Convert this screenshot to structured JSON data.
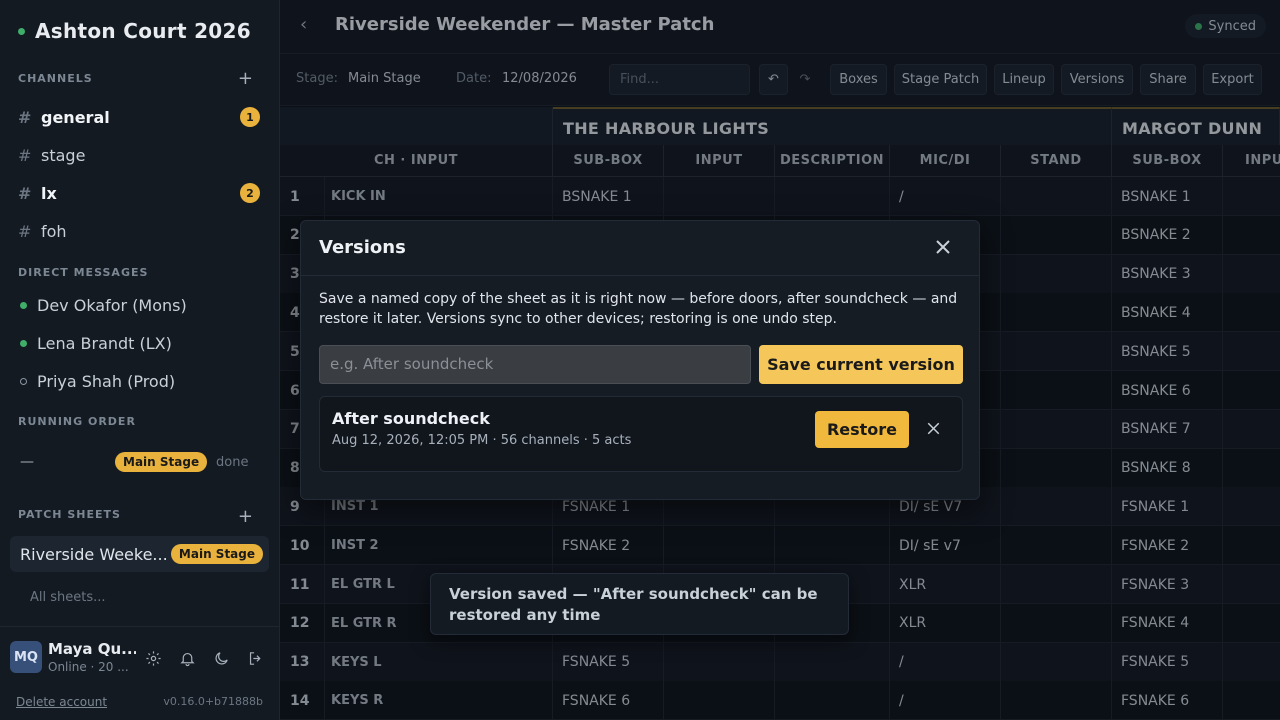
{
  "sidebar": {
    "workspace": "Ashton Court 2026",
    "sections": {
      "channels": "CHANNELS",
      "dms": "DIRECT MESSAGES",
      "running_order": "RUNNING ORDER",
      "patch_sheets": "PATCH SHEETS"
    },
    "channels": [
      {
        "name": "general",
        "badge": "1",
        "bold": true
      },
      {
        "name": "stage",
        "badge": "",
        "bold": false
      },
      {
        "name": "lx",
        "badge": "2",
        "bold": true
      },
      {
        "name": "foh",
        "badge": "",
        "bold": false
      }
    ],
    "dms": [
      {
        "name": "Dev Okafor (Mons)",
        "online": true
      },
      {
        "name": "Lena Brandt (LX)",
        "online": true
      },
      {
        "name": "Priya Shah (Prod)",
        "online": false
      }
    ],
    "running_order": {
      "dash": "—",
      "stage": "Main Stage",
      "status": "done"
    },
    "patch_sheet": {
      "name": "Riverside Weeke...",
      "stage": "Main Stage"
    },
    "all_sheets": "All sheets...",
    "user": {
      "initials": "MQ",
      "name": "Maya Qu...",
      "status": "Online · 20 ...",
      "delete": "Delete account",
      "version": "v0.16.0+b71888b"
    }
  },
  "header": {
    "back": "‹",
    "title": "Riverside Weekender — Master Patch",
    "synced": "Synced"
  },
  "toolbar": {
    "stage_label": "Stage:",
    "stage_value": "Main Stage",
    "date_label": "Date:",
    "date_value": "12/08/2026",
    "find_placeholder": "Find...",
    "undo": "↶",
    "redo": "↷",
    "buttons": [
      "Boxes",
      "Stage Patch",
      "Lineup",
      "Versions",
      "Share",
      "Export"
    ]
  },
  "grid": {
    "acts": [
      "THE HARBOUR LIGHTS",
      "MARGOT DUNN"
    ],
    "columns": [
      "CH · INPUT",
      "SUB-BOX",
      "INPUT",
      "DESCRIPTION",
      "MIC/DI",
      "STAND",
      "SUB-BOX",
      "INPUT"
    ],
    "rows": [
      {
        "ch": "1",
        "input": "KICK IN",
        "sub1": "BSNAKE 1",
        "mic": "/",
        "sub2": "BSNAKE 1"
      },
      {
        "ch": "2",
        "input": "",
        "sub1": "",
        "mic": "",
        "sub2": "BSNAKE 2"
      },
      {
        "ch": "3",
        "input": "",
        "sub1": "",
        "mic": "",
        "sub2": "BSNAKE 3"
      },
      {
        "ch": "4",
        "input": "",
        "sub1": "",
        "mic": "",
        "sub2": "BSNAKE 4"
      },
      {
        "ch": "5",
        "input": "",
        "sub1": "",
        "mic": "",
        "sub2": "BSNAKE 5"
      },
      {
        "ch": "6",
        "input": "",
        "sub1": "",
        "mic": "",
        "sub2": "BSNAKE 6"
      },
      {
        "ch": "7",
        "input": "",
        "sub1": "",
        "mic": "",
        "sub2": "BSNAKE 7"
      },
      {
        "ch": "8",
        "input": "",
        "sub1": "",
        "mic": "",
        "sub2": "BSNAKE 8"
      },
      {
        "ch": "9",
        "input": "INST 1",
        "sub1": "FSNAKE 1",
        "mic": "DI/ sE V7",
        "sub2": "FSNAKE 1"
      },
      {
        "ch": "10",
        "input": "INST 2",
        "sub1": "FSNAKE 2",
        "mic": "DI/ sE v7",
        "sub2": "FSNAKE 2"
      },
      {
        "ch": "11",
        "input": "EL GTR L",
        "sub1": "",
        "mic": "XLR",
        "sub2": "FSNAKE 3"
      },
      {
        "ch": "12",
        "input": "EL GTR R",
        "sub1": "",
        "mic": "XLR",
        "sub2": "FSNAKE 4"
      },
      {
        "ch": "13",
        "input": "KEYS L",
        "sub1": "FSNAKE 5",
        "mic": "/",
        "sub2": "FSNAKE 5"
      },
      {
        "ch": "14",
        "input": "KEYS R",
        "sub1": "FSNAKE 6",
        "mic": "/",
        "sub2": "FSNAKE 6"
      }
    ]
  },
  "modal": {
    "title": "Versions",
    "description": "Save a named copy of the sheet as it is right now — before doors, after soundcheck — and restore it later. Versions sync to other devices; restoring is one undo step.",
    "input_placeholder": "e.g. After soundcheck",
    "save_label": "Save current version",
    "version": {
      "name": "After soundcheck",
      "meta": "Aug 12, 2026, 12:05 PM · 56 channels · 5 acts",
      "restore_label": "Restore"
    }
  },
  "toast": {
    "message": "Version saved — \"After soundcheck\" can be restored any time"
  },
  "colors": {
    "accent": "#f0b83c",
    "online": "#3fae6a",
    "background": "#0f141b",
    "panel": "#141a22"
  }
}
